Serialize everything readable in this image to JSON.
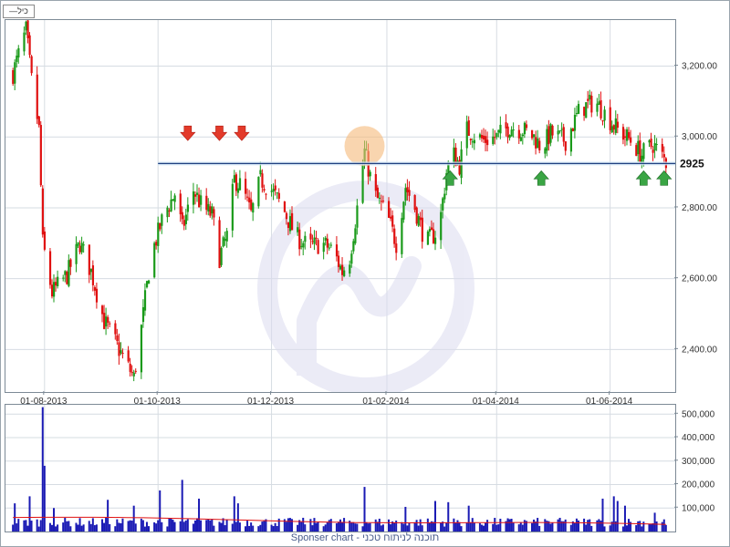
{
  "legend": {
    "label": "—כיל"
  },
  "footer": {
    "credit": "Sponser chart - תוכנה לניתוח טכני"
  },
  "colors": {
    "up": "#1a9a1a",
    "down": "#e01010",
    "volume": "#1a1ab4",
    "volume_ma": "#e01010",
    "trendline": "#1f3f7f",
    "up_arrow": "#3aa544",
    "down_arrow": "#e33a2a",
    "highlight": "#f5b97a",
    "grid": "#d6dce2",
    "watermark": "#dcdcf0"
  },
  "chart_data": [
    {
      "type": "candlestick",
      "panel": "price",
      "x_tick_labels": [
        "01-08-2013",
        "01-10-2013",
        "01-12-2013",
        "01-02-2014",
        "01-04-2014",
        "01-06-2014"
      ],
      "y_ticks": [
        2400,
        2600,
        2800,
        3000,
        3200
      ],
      "y_tick_labels": [
        "2,400.00",
        "2,600.00",
        "2,800.00",
        "3,000.00",
        "3,200.00"
      ],
      "ylim": [
        2280,
        3330
      ],
      "grid": true,
      "price_label": "2925",
      "support_level": 2925,
      "support_line_start": "2013-10-01",
      "highlight_date": "2014-01-20",
      "down_arrow_dates": [
        "2013-10-17",
        "2013-11-03",
        "2013-11-15"
      ],
      "up_arrow_dates": [
        "2014-03-07",
        "2014-04-25",
        "2014-06-19",
        "2014-06-30"
      ],
      "anchors": [
        [
          "2013-07-15",
          3180
        ],
        [
          "2013-07-22",
          3300
        ],
        [
          "2013-07-25",
          3160
        ],
        [
          "2013-07-29",
          3020
        ],
        [
          "2013-07-31",
          2700
        ],
        [
          "2013-08-05",
          2560
        ],
        [
          "2013-08-13",
          2610
        ],
        [
          "2013-08-20",
          2700
        ],
        [
          "2013-08-26",
          2620
        ],
        [
          "2013-09-02",
          2480
        ],
        [
          "2013-09-10",
          2400
        ],
        [
          "2013-09-18",
          2320
        ],
        [
          "2013-09-22",
          2460
        ],
        [
          "2013-09-27",
          2660
        ],
        [
          "2013-10-04",
          2780
        ],
        [
          "2013-10-10",
          2840
        ],
        [
          "2013-10-14",
          2740
        ],
        [
          "2013-10-20",
          2850
        ],
        [
          "2013-10-25",
          2800
        ],
        [
          "2013-10-30",
          2780
        ],
        [
          "2013-11-03",
          2660
        ],
        [
          "2013-11-07",
          2720
        ],
        [
          "2013-11-11",
          2880
        ],
        [
          "2013-11-15",
          2860
        ],
        [
          "2013-11-20",
          2780
        ],
        [
          "2013-11-25",
          2880
        ],
        [
          "2013-12-01",
          2850
        ],
        [
          "2013-12-07",
          2800
        ],
        [
          "2013-12-14",
          2720
        ],
        [
          "2013-12-21",
          2690
        ],
        [
          "2013-12-28",
          2700
        ],
        [
          "2014-01-03",
          2680
        ],
        [
          "2014-01-08",
          2620
        ],
        [
          "2014-01-12",
          2660
        ],
        [
          "2014-01-16",
          2800
        ],
        [
          "2014-01-20",
          2960
        ],
        [
          "2014-01-25",
          2840
        ],
        [
          "2014-02-01",
          2780
        ],
        [
          "2014-02-06",
          2700
        ],
        [
          "2014-02-11",
          2860
        ],
        [
          "2014-02-16",
          2800
        ],
        [
          "2014-02-22",
          2700
        ],
        [
          "2014-03-01",
          2740
        ],
        [
          "2014-03-05",
          2900
        ],
        [
          "2014-03-08",
          2960
        ],
        [
          "2014-03-12",
          2920
        ],
        [
          "2014-03-16",
          3020
        ],
        [
          "2014-03-25",
          2990
        ],
        [
          "2014-04-01",
          3000
        ],
        [
          "2014-04-08",
          3030
        ],
        [
          "2014-04-15",
          3020
        ],
        [
          "2014-04-21",
          3000
        ],
        [
          "2014-04-25",
          2970
        ],
        [
          "2014-04-30",
          3010
        ],
        [
          "2014-05-08",
          2990
        ],
        [
          "2014-05-16",
          3080
        ],
        [
          "2014-05-24",
          3100
        ],
        [
          "2014-05-30",
          3060
        ],
        [
          "2014-06-05",
          3020
        ],
        [
          "2014-06-12",
          2990
        ],
        [
          "2014-06-18",
          2950
        ],
        [
          "2014-06-24",
          2980
        ],
        [
          "2014-07-01",
          2930
        ]
      ]
    },
    {
      "type": "bar",
      "panel": "volume",
      "y_ticks": [
        100000,
        200000,
        300000,
        400000,
        500000
      ],
      "y_tick_labels": [
        "100,000",
        "200,000",
        "300,000",
        "400,000",
        "500,000"
      ],
      "ylim": [
        0,
        540000
      ],
      "base_volume": 42000,
      "moving_average_start": 60000,
      "moving_average_end": 28000,
      "spikes": [
        [
          "2013-07-16",
          120000
        ],
        [
          "2013-07-24",
          150000
        ],
        [
          "2013-07-31",
          530000
        ],
        [
          "2013-08-01",
          280000
        ],
        [
          "2013-08-02",
          185000
        ],
        [
          "2013-08-06",
          100000
        ],
        [
          "2013-08-16",
          160000
        ],
        [
          "2013-09-04",
          135000
        ],
        [
          "2013-09-18",
          110000
        ],
        [
          "2013-10-02",
          175000
        ],
        [
          "2013-10-11",
          120000
        ],
        [
          "2013-10-14",
          220000
        ],
        [
          "2013-10-23",
          140000
        ],
        [
          "2013-11-11",
          150000
        ],
        [
          "2013-11-13",
          120000
        ],
        [
          "2013-11-22",
          125000
        ],
        [
          "2014-01-17",
          160000
        ],
        [
          "2014-01-20",
          190000
        ],
        [
          "2014-02-11",
          105000
        ],
        [
          "2014-02-27",
          130000
        ],
        [
          "2014-03-06",
          125000
        ],
        [
          "2014-03-17",
          110000
        ],
        [
          "2014-05-28",
          140000
        ],
        [
          "2014-06-03",
          150000
        ],
        [
          "2014-06-05",
          130000
        ],
        [
          "2014-06-09",
          110000
        ],
        [
          "2014-06-25",
          80000
        ]
      ]
    }
  ]
}
